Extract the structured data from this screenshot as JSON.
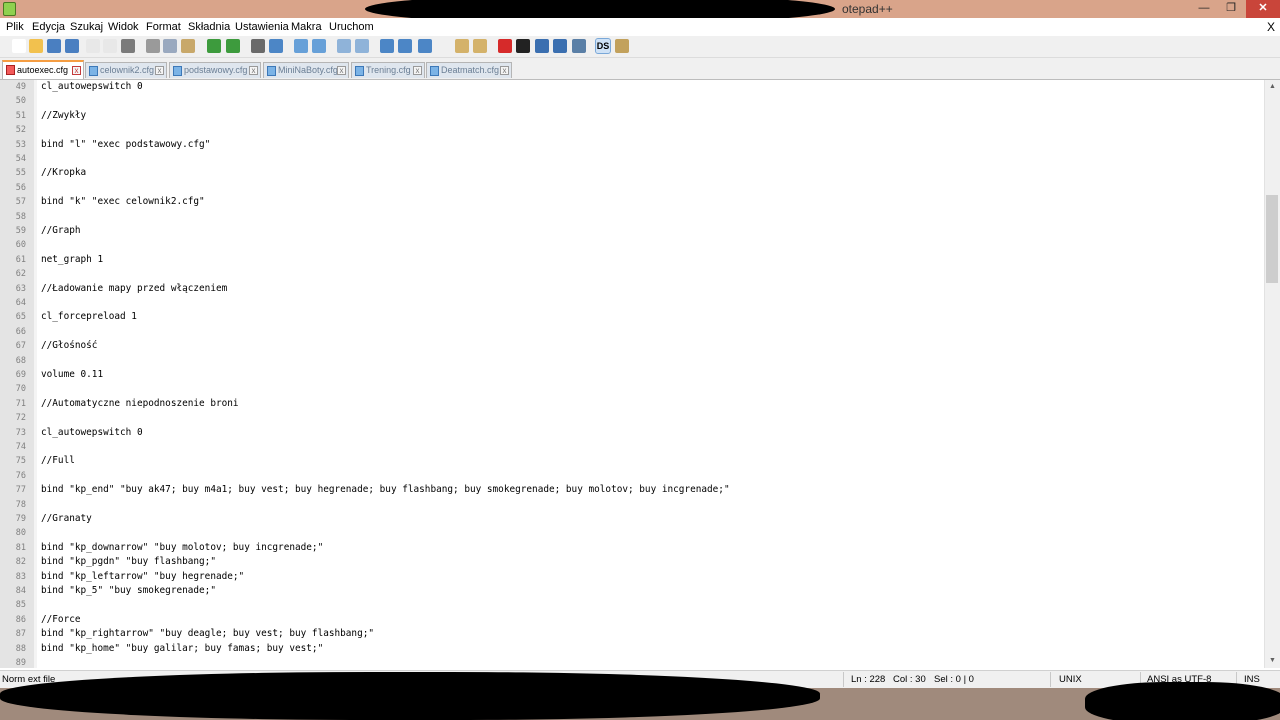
{
  "window": {
    "title": "otepad++",
    "minimize_glyph": "—",
    "restore_glyph": "❐",
    "close_glyph": "✕"
  },
  "menu": {
    "items": [
      "Plik",
      "Edycja",
      "Szukaj",
      "Widok",
      "Format",
      "Składnia",
      "Ustawienia",
      "Makra",
      "Uruchom"
    ],
    "doc_close": "X"
  },
  "toolbar": {
    "buttons": [
      {
        "icon": "new-file-icon",
        "color": "#ffffff"
      },
      {
        "icon": "open-file-icon",
        "color": "#f2c14e"
      },
      {
        "icon": "save-icon",
        "color": "#4a7fc1"
      },
      {
        "icon": "save-all-icon",
        "color": "#4a7fc1"
      },
      {
        "icon": "close-file-icon",
        "color": "#e8e8e8"
      },
      {
        "icon": "close-all-icon",
        "color": "#e8e8e8"
      },
      {
        "icon": "print-icon",
        "color": "#7b7b7b"
      },
      {
        "icon": "cut-icon",
        "color": "#9a9a9a"
      },
      {
        "icon": "copy-icon",
        "color": "#9aa9bf"
      },
      {
        "icon": "paste-icon",
        "color": "#c8a86a"
      },
      {
        "icon": "undo-icon",
        "color": "#3d9b3d"
      },
      {
        "icon": "redo-icon",
        "color": "#3d9b3d"
      },
      {
        "icon": "find-icon",
        "color": "#6a6a6a"
      },
      {
        "icon": "replace-icon",
        "color": "#4c86c6"
      },
      {
        "icon": "zoom-in-icon",
        "color": "#67a0d8"
      },
      {
        "icon": "zoom-out-icon",
        "color": "#67a0d8"
      },
      {
        "icon": "sync-vertical-icon",
        "color": "#8fb3d9"
      },
      {
        "icon": "sync-horizontal-icon",
        "color": "#8fb3d9"
      },
      {
        "icon": "word-wrap-icon",
        "color": "#4c86c6"
      },
      {
        "icon": "show-all-chars-icon",
        "color": "#4c86c6"
      },
      {
        "icon": "indent-guide-icon",
        "color": "#4c86c6"
      },
      {
        "icon": "user-language-icon",
        "color": "#f0f0f0"
      },
      {
        "icon": "doc-map-icon",
        "color": "#d4b26a"
      },
      {
        "icon": "function-list-icon",
        "color": "#d4b26a"
      },
      {
        "icon": "macro-record-icon",
        "color": "#d62a2a"
      },
      {
        "icon": "macro-stop-icon",
        "color": "#222222"
      },
      {
        "icon": "macro-play-icon",
        "color": "#3b6fb0"
      },
      {
        "icon": "macro-run-multiple-icon",
        "color": "#3b6fb0"
      },
      {
        "icon": "macro-save-icon",
        "color": "#5a7fa6"
      },
      {
        "icon": "ds-icon",
        "color": "#cfe2f6",
        "label": "DS"
      },
      {
        "icon": "plugin-icon",
        "color": "#c2a15c"
      }
    ]
  },
  "tabs": [
    {
      "label": "autoexec.cfg",
      "active": true
    },
    {
      "label": "celownik2.cfg",
      "active": false
    },
    {
      "label": "podstawowy.cfg",
      "active": false
    },
    {
      "label": "MiniNaBoty.cfg",
      "active": false
    },
    {
      "label": "Trening.cfg",
      "active": false
    },
    {
      "label": "Deatmatch.cfg",
      "active": false
    }
  ],
  "tab_close_glyph": "x",
  "editor": {
    "lines": [
      {
        "n": "49",
        "text": "cl_autowepswitch 0"
      },
      {
        "n": "50",
        "text": ""
      },
      {
        "n": "51",
        "text": "//Zwykły"
      },
      {
        "n": "52",
        "text": ""
      },
      {
        "n": "53",
        "text": "bind \"l\" \"exec podstawowy.cfg\""
      },
      {
        "n": "54",
        "text": ""
      },
      {
        "n": "55",
        "text": "//Kropka"
      },
      {
        "n": "56",
        "text": ""
      },
      {
        "n": "57",
        "text": "bind \"k\" \"exec celownik2.cfg\""
      },
      {
        "n": "58",
        "text": ""
      },
      {
        "n": "59",
        "text": "//Graph"
      },
      {
        "n": "60",
        "text": ""
      },
      {
        "n": "61",
        "text": "net_graph 1"
      },
      {
        "n": "62",
        "text": ""
      },
      {
        "n": "63",
        "text": "//Ładowanie mapy przed włączeniem"
      },
      {
        "n": "64",
        "text": ""
      },
      {
        "n": "65",
        "text": "cl_forcepreload 1"
      },
      {
        "n": "66",
        "text": ""
      },
      {
        "n": "67",
        "text": "//Głośność"
      },
      {
        "n": "68",
        "text": ""
      },
      {
        "n": "69",
        "text": "volume 0.11"
      },
      {
        "n": "70",
        "text": ""
      },
      {
        "n": "71",
        "text": "//Automatyczne niepodnoszenie broni"
      },
      {
        "n": "72",
        "text": ""
      },
      {
        "n": "73",
        "text": "cl_autowepswitch 0"
      },
      {
        "n": "74",
        "text": ""
      },
      {
        "n": "75",
        "text": "//Full"
      },
      {
        "n": "76",
        "text": ""
      },
      {
        "n": "77",
        "text": "bind \"kp_end\" \"buy ak47; buy m4a1; buy vest; buy hegrenade; buy flashbang; buy smokegrenade; buy molotov; buy incgrenade;\""
      },
      {
        "n": "78",
        "text": ""
      },
      {
        "n": "79",
        "text": "//Granaty"
      },
      {
        "n": "80",
        "text": ""
      },
      {
        "n": "81",
        "text": "bind \"kp_downarrow\" \"buy molotov; buy incgrenade;\""
      },
      {
        "n": "82",
        "text": "bind \"kp_pgdn\" \"buy flashbang;\""
      },
      {
        "n": "83",
        "text": "bind \"kp_leftarrow\" \"buy hegrenade;\""
      },
      {
        "n": "84",
        "text": "bind \"kp_5\" \"buy smokegrenade;\""
      },
      {
        "n": "85",
        "text": ""
      },
      {
        "n": "86",
        "text": "//Force"
      },
      {
        "n": "87",
        "text": "bind \"kp_rightarrow\" \"buy deagle; buy vest; buy flashbang;\""
      },
      {
        "n": "88",
        "text": "bind \"kp_home\" \"buy galilar; buy famas; buy vest;\""
      },
      {
        "n": "89",
        "text": ""
      }
    ]
  },
  "scrollbar": {
    "up_glyph": "▲",
    "down_glyph": "▼"
  },
  "status": {
    "file_type": "Norm        ext file",
    "ln": "Ln : 228",
    "col": "Col : 30",
    "sel": "Sel : 0 | 0",
    "eol": "UNIX",
    "encoding": "ANSI as UTF-8",
    "mode": "INS"
  },
  "colors": {
    "title_bar": "#d9a48a",
    "active_tab_accent": "#f59d42",
    "gutter": "#e4e4e4"
  }
}
